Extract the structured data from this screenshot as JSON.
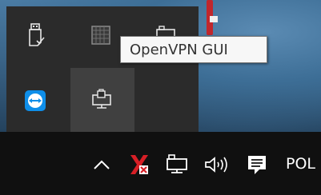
{
  "tooltip": {
    "text": "OpenVPN GUI"
  },
  "overflow_icons": [
    {
      "icon": "usb-eject-icon"
    },
    {
      "icon": "grid-app-icon"
    },
    {
      "icon": "network-monitor-icon"
    },
    {
      "icon": "teamviewer-icon"
    },
    {
      "icon": "openvpn-icon",
      "selected": true
    }
  ],
  "taskbar": {
    "language": "POL",
    "icons": [
      "chevron-up-icon",
      "antivirus-icon",
      "network-icon",
      "volume-icon",
      "action-center-icon"
    ]
  },
  "colors": {
    "tray_background": "#2b2b2b",
    "taskbar_background": "#101010",
    "teamviewer_blue": "#0e8ee9",
    "antivirus_red": "#d71f26"
  }
}
